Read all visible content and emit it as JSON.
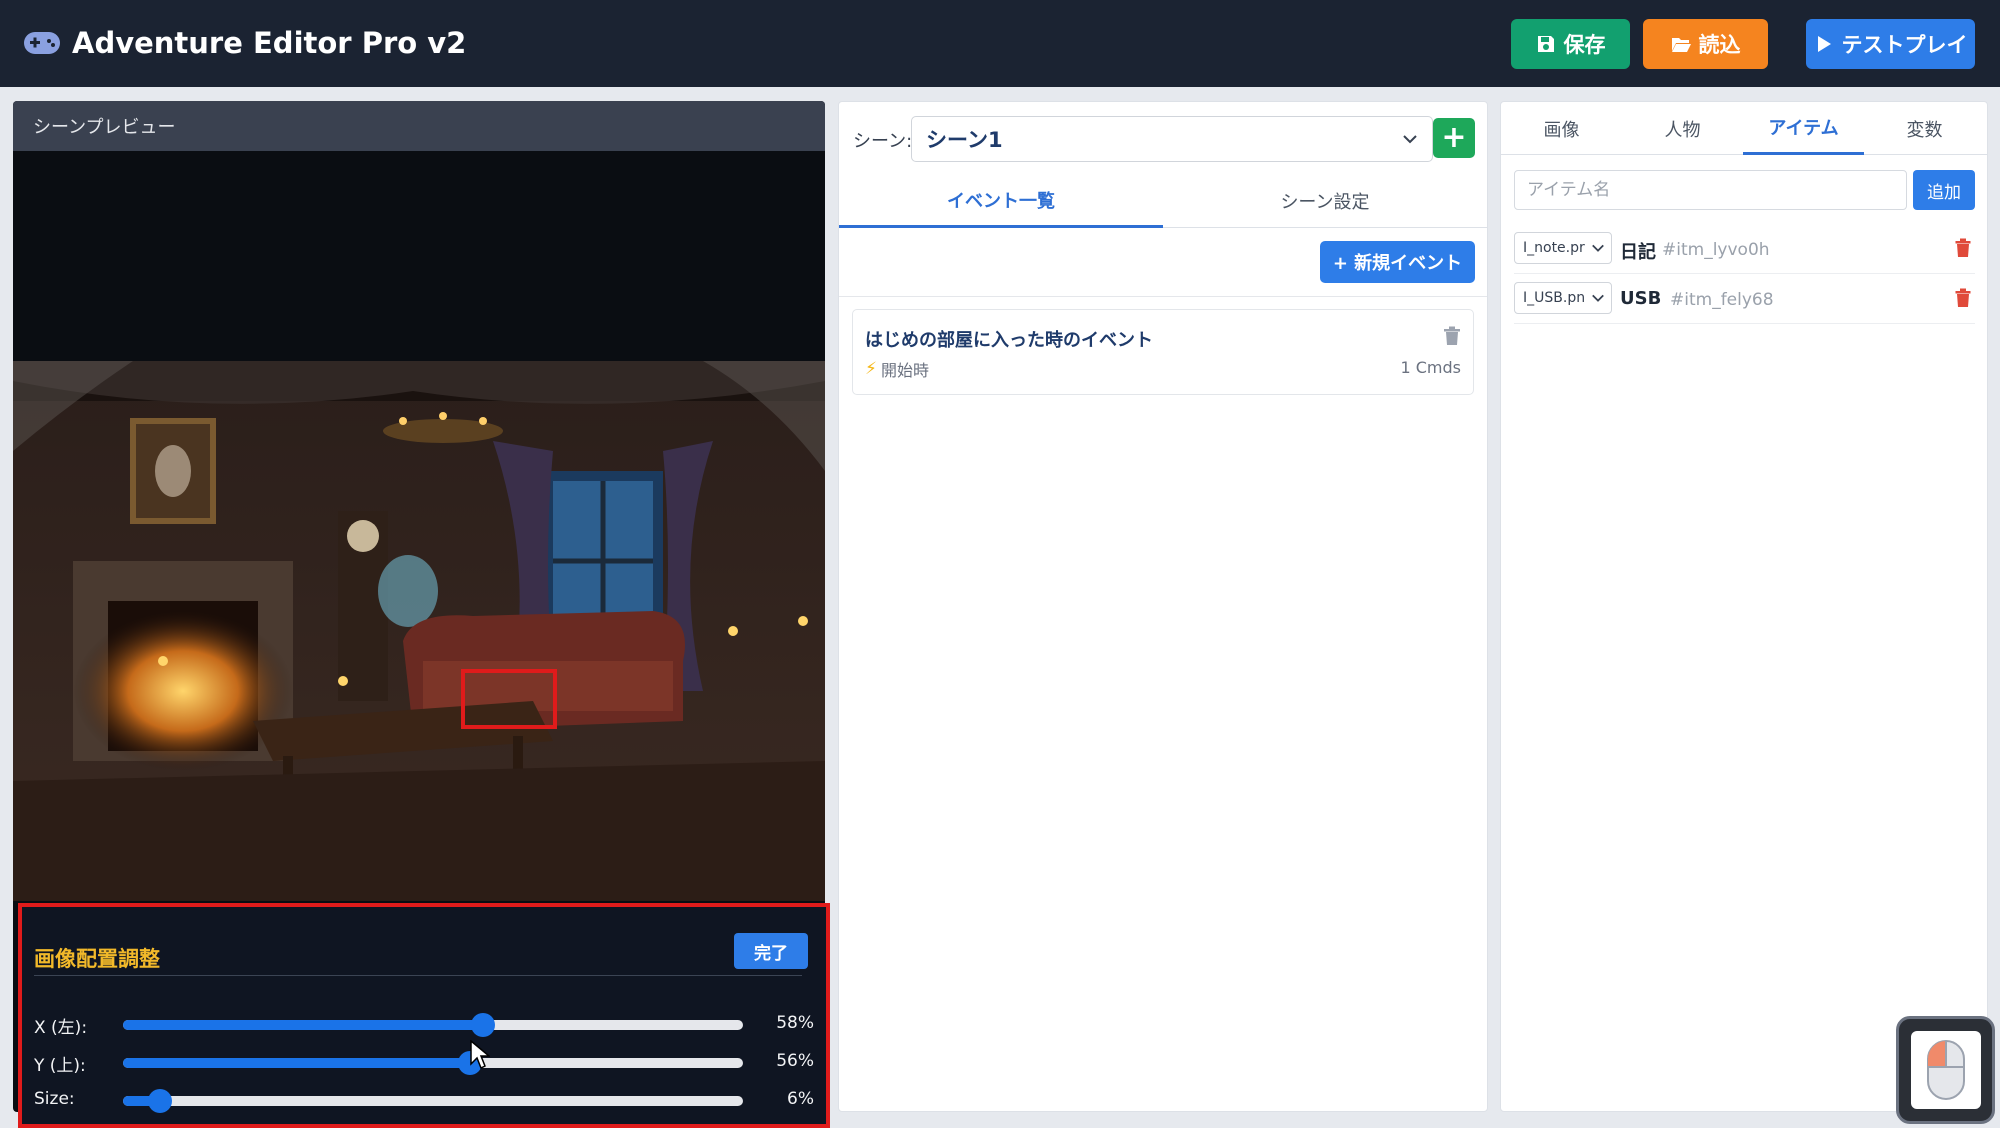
{
  "header": {
    "title": "Adventure Editor Pro v2",
    "save_label": "保存",
    "load_label": "読込",
    "test_label": "テストプレイ",
    "colors": {
      "bg": "#1b2332",
      "save": "#12a06f",
      "load": "#f5841f",
      "test": "#2e7de8"
    }
  },
  "preview": {
    "header": "シーンプレビュー",
    "adjust": {
      "title": "画像配置調整",
      "done_label": "完了",
      "sliders": [
        {
          "label": "X (左):",
          "value": 58,
          "display": "58%"
        },
        {
          "label": "Y (上):",
          "value": 56,
          "display": "56%"
        },
        {
          "label": "Size:",
          "value": 6,
          "display": "6%"
        }
      ]
    }
  },
  "scene": {
    "label": "シーン:",
    "selected": "シーン1",
    "add_label": "+",
    "tabs": [
      {
        "label": "イベント一覧",
        "active": true
      },
      {
        "label": "シーン設定",
        "active": false
      }
    ],
    "new_event_label": "+ 新規イベント",
    "events": [
      {
        "title": "はじめの部屋に入った時のイベント",
        "trigger": "開始時",
        "cmds": "1 Cmds"
      }
    ]
  },
  "right": {
    "tabs": [
      {
        "label": "画像",
        "active": false
      },
      {
        "label": "人物",
        "active": false
      },
      {
        "label": "アイテム",
        "active": true
      },
      {
        "label": "変数",
        "active": false
      }
    ],
    "item_input_placeholder": "アイテム名",
    "add_label": "追加",
    "items": [
      {
        "image": "I_note.pr",
        "name": "日記",
        "id": "#itm_lyvo0h"
      },
      {
        "image": "I_USB.pn",
        "name": "USB",
        "id": "#itm_fely68"
      }
    ]
  }
}
